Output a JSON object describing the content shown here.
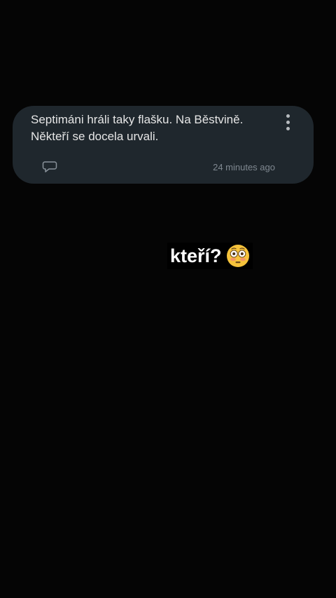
{
  "post": {
    "text": "Septimáni hráli taky flašku. Na Běstvině. Někteří se docela urvali.",
    "timestamp": "24 minutes ago",
    "menu_icon": "more-vertical-icon",
    "comment_icon": "comment-bubble-icon"
  },
  "sticker": {
    "text": "kteří?",
    "emoji": "flushed-face-emoji"
  },
  "colors": {
    "background": "#050505",
    "card": "#1f272d",
    "card_text": "#e6e6e6",
    "muted_text": "#7f8890",
    "emoji_face": "#f6c33b"
  }
}
